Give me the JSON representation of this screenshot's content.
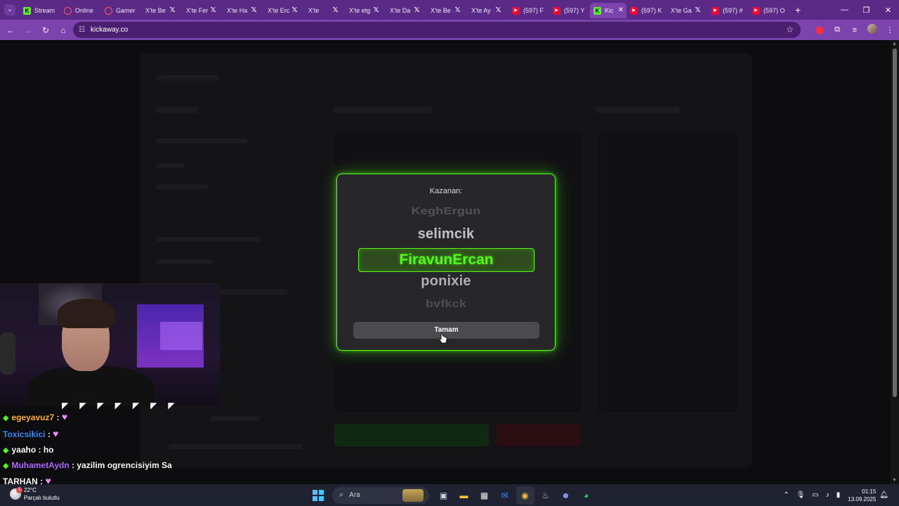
{
  "browser": {
    "tabs": [
      {
        "title": "Stream",
        "icon": "k"
      },
      {
        "title": "Online",
        "icon": "ot"
      },
      {
        "title": "Gamer",
        "icon": "ot"
      },
      {
        "title": "X'te Be",
        "icon": "x"
      },
      {
        "title": "X'te Fer",
        "icon": "x"
      },
      {
        "title": "X'te Ha",
        "icon": "x"
      },
      {
        "title": "X'te Erc",
        "icon": "x"
      },
      {
        "title": "X'te",
        "icon": "x"
      },
      {
        "title": "X'te etg",
        "icon": "x"
      },
      {
        "title": "X'te Da",
        "icon": "x"
      },
      {
        "title": "X'te Be",
        "icon": "x"
      },
      {
        "title": "X'te Ay",
        "icon": "x"
      },
      {
        "title": "(597) F",
        "icon": "yt"
      },
      {
        "title": "(597) Y",
        "icon": "yt"
      },
      {
        "title": "Kic",
        "icon": "k",
        "active": true
      },
      {
        "title": "(597) K",
        "icon": "yt"
      },
      {
        "title": "X'te Ga",
        "icon": "x"
      },
      {
        "title": "(597) #",
        "icon": "yt"
      },
      {
        "title": "(597) O",
        "icon": "yt"
      }
    ],
    "url": "kickaway.co"
  },
  "modal": {
    "caption": "Kazanan:",
    "names": [
      "KeghErgun",
      "selimcik",
      "FiravunErcan",
      "ponixie",
      "bvfkck"
    ],
    "winner": "FiravunErcan",
    "ok_label": "Tamam",
    "accent": "#53fc18"
  },
  "chat": {
    "messages": [
      {
        "user": "egeyavuz7",
        "text": "",
        "emote": true
      },
      {
        "user": "Toxicsikici",
        "text": "",
        "emote": true
      },
      {
        "user": "yaaho",
        "text": "ho",
        "emote": false
      },
      {
        "user": "MuhametAydn",
        "text": "yazilim ogrencisiyim Sa",
        "emote": false
      },
      {
        "user": "TARHAN",
        "text": "",
        "emote": true
      }
    ]
  },
  "taskbar": {
    "weather_temp": "22°C",
    "weather_desc": "Parçalı bulutlu",
    "weather_badge": "1",
    "search_label": "Ara",
    "time": "01:15",
    "date": "13.09.2025"
  }
}
